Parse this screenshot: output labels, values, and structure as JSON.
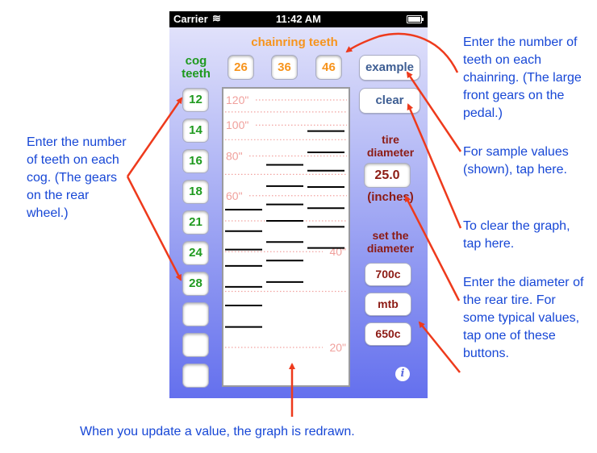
{
  "status_bar": {
    "carrier": "Carrier",
    "time": "11:42 AM",
    "wifi_icon": "wifi-icon",
    "battery_icon": "battery-icon"
  },
  "chainring": {
    "label": "chainring teeth",
    "values": [
      "26",
      "36",
      "46"
    ]
  },
  "cog": {
    "label_line1": "cog",
    "label_line2": "teeth",
    "values": [
      "12",
      "14",
      "16",
      "18",
      "21",
      "24",
      "28",
      "",
      "",
      ""
    ]
  },
  "buttons": {
    "example": "example",
    "clear": "clear"
  },
  "tire": {
    "label_line1": "tire",
    "label_line2": "diameter",
    "value": "25.0",
    "unit": "(inches)"
  },
  "set_diameter": {
    "label_line1": "set the",
    "label_line2": "diameter",
    "presets": [
      "700c",
      "mtb",
      "650c"
    ]
  },
  "info_icon": "i",
  "chart_data": {
    "type": "line",
    "description": "gear inches per chainring/cog combination (log scale)",
    "y_scale": "log",
    "ylim": [
      18,
      128
    ],
    "gridlines": [
      120,
      110,
      100,
      90,
      80,
      70,
      60,
      50,
      40,
      30,
      20
    ],
    "tick_labels": [
      {
        "value": 120,
        "label": "120\"",
        "side": "left"
      },
      {
        "value": 100,
        "label": "100\"",
        "side": "left"
      },
      {
        "value": 80,
        "label": "80\"",
        "side": "left"
      },
      {
        "value": 60,
        "label": "60\"",
        "side": "left"
      },
      {
        "value": 40,
        "label": "40\"",
        "side": "right"
      },
      {
        "value": 20,
        "label": "20\"",
        "side": "right"
      }
    ],
    "series": [
      {
        "name": "26",
        "values": [
          54.2,
          46.4,
          40.6,
          36.1,
          31.0,
          27.1,
          23.2
        ]
      },
      {
        "name": "36",
        "values": [
          75.0,
          64.3,
          56.3,
          50.0,
          42.9,
          37.5,
          32.1
        ]
      },
      {
        "name": "46",
        "values": [
          95.8,
          82.1,
          71.9,
          63.9,
          54.8,
          47.9,
          41.1
        ]
      }
    ]
  },
  "annotations": {
    "chainring": "Enter the number of teeth on each chainring. (The large front gears on the pedal.)",
    "example": "For sample values (shown), tap here.",
    "clear": "To clear the graph, tap here.",
    "tire": "Enter the diameter of the rear tire. For some typical values, tap one of these buttons.",
    "cog": "Enter the number of teeth on each cog. (The gears on the rear wheel.)",
    "graph": "When you update a value, the graph is redrawn."
  },
  "colors": {
    "arrow": "#ee3a1c",
    "annotation": "#1747d6",
    "chainring": "#f7941d",
    "cog": "#1f9a1f",
    "tire": "#8c1b14",
    "grid": "#f2a3a0"
  }
}
